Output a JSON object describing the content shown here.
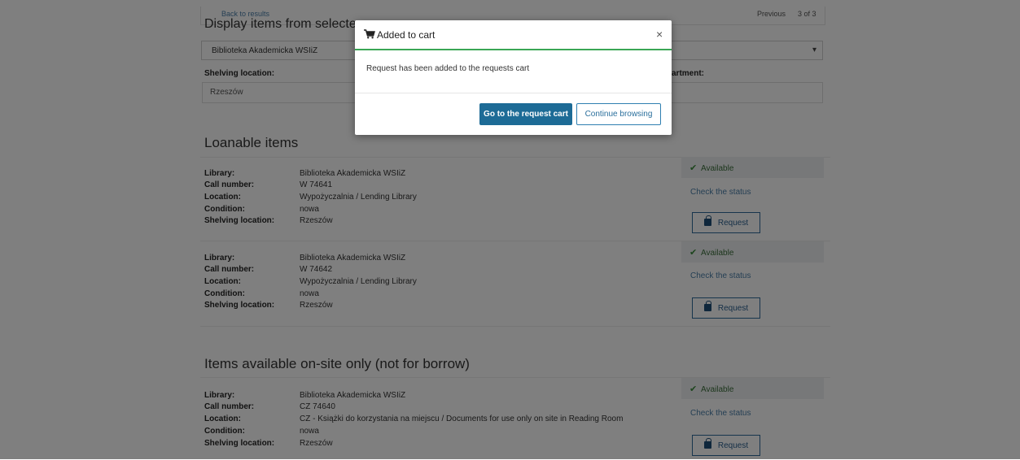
{
  "nav": {
    "back_label": "Back to results",
    "previous_label": "Previous",
    "position_label": "3 of 3"
  },
  "display_section": {
    "title": "Display items from selected",
    "select_value": "Biblioteka Akademicka WSIiZ",
    "shelving_label": "Shelving location:",
    "department_label": "artment:",
    "shelving_value": "Rzeszów"
  },
  "loanable": {
    "heading": "Loanable items",
    "items": [
      {
        "library": "Biblioteka Akademicka WSIiZ",
        "call_number": "W 74641",
        "location": "Wypożyczalnia / Lending Library",
        "condition": "nowa",
        "shelving": "Rzeszów",
        "status": "Available",
        "check_status": "Check the status",
        "request": "Request"
      },
      {
        "library": "Biblioteka Akademicka WSIiZ",
        "call_number": "W 74642",
        "location": "Wypożyczalnia / Lending Library",
        "condition": "nowa",
        "shelving": "Rzeszów",
        "status": "Available",
        "check_status": "Check the status",
        "request": "Request"
      }
    ]
  },
  "onsite": {
    "heading": "Items available on-site only (not for borrow)",
    "items": [
      {
        "library": "Biblioteka Akademicka WSIiZ",
        "call_number": "CZ 74640",
        "location": "CZ - Książki do korzystania na miejscu / Documents for use only on site in Reading Room",
        "condition": "nowa",
        "shelving": "Rzeszów",
        "status": "Available",
        "check_status": "Check the status",
        "request": "Request"
      }
    ]
  },
  "labels": {
    "library": "Library:",
    "call_number": "Call number:",
    "location": "Location:",
    "condition": "Condition:",
    "shelving": "Shelving location:"
  },
  "modal": {
    "title": "Added to cart",
    "close": "×",
    "message": "Request has been added to the requests cart",
    "primary_button": "Go to the request cart",
    "secondary_button": "Continue browsing"
  },
  "icons": {
    "cart": "shopping-cart-icon",
    "check": "check-icon",
    "lock": "lock-icon",
    "chevron": "chevron-down-icon"
  },
  "colors": {
    "primary": "#1d6b96",
    "link": "#1b5e8f",
    "success": "#3aa655",
    "overlay": "rgba(0,0,0,0.50)"
  }
}
